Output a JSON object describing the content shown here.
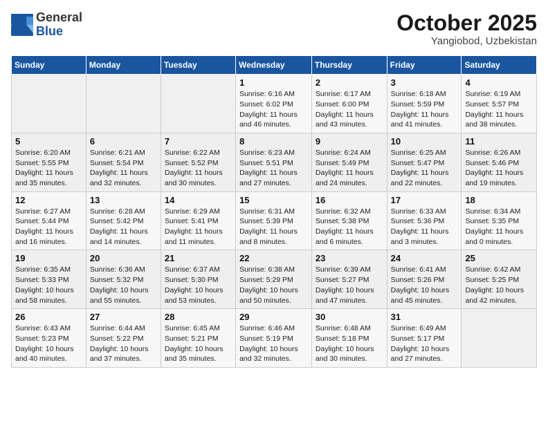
{
  "header": {
    "logo": {
      "general": "General",
      "blue": "Blue"
    },
    "month": "October 2025",
    "location": "Yangiobod, Uzbekistan"
  },
  "weekdays": [
    "Sunday",
    "Monday",
    "Tuesday",
    "Wednesday",
    "Thursday",
    "Friday",
    "Saturday"
  ],
  "weeks": [
    [
      {
        "day": "",
        "detail": ""
      },
      {
        "day": "",
        "detail": ""
      },
      {
        "day": "",
        "detail": ""
      },
      {
        "day": "1",
        "detail": "Sunrise: 6:16 AM\nSunset: 6:02 PM\nDaylight: 11 hours and 46 minutes."
      },
      {
        "day": "2",
        "detail": "Sunrise: 6:17 AM\nSunset: 6:00 PM\nDaylight: 11 hours and 43 minutes."
      },
      {
        "day": "3",
        "detail": "Sunrise: 6:18 AM\nSunset: 5:59 PM\nDaylight: 11 hours and 41 minutes."
      },
      {
        "day": "4",
        "detail": "Sunrise: 6:19 AM\nSunset: 5:57 PM\nDaylight: 11 hours and 38 minutes."
      }
    ],
    [
      {
        "day": "5",
        "detail": "Sunrise: 6:20 AM\nSunset: 5:55 PM\nDaylight: 11 hours and 35 minutes."
      },
      {
        "day": "6",
        "detail": "Sunrise: 6:21 AM\nSunset: 5:54 PM\nDaylight: 11 hours and 32 minutes."
      },
      {
        "day": "7",
        "detail": "Sunrise: 6:22 AM\nSunset: 5:52 PM\nDaylight: 11 hours and 30 minutes."
      },
      {
        "day": "8",
        "detail": "Sunrise: 6:23 AM\nSunset: 5:51 PM\nDaylight: 11 hours and 27 minutes."
      },
      {
        "day": "9",
        "detail": "Sunrise: 6:24 AM\nSunset: 5:49 PM\nDaylight: 11 hours and 24 minutes."
      },
      {
        "day": "10",
        "detail": "Sunrise: 6:25 AM\nSunset: 5:47 PM\nDaylight: 11 hours and 22 minutes."
      },
      {
        "day": "11",
        "detail": "Sunrise: 6:26 AM\nSunset: 5:46 PM\nDaylight: 11 hours and 19 minutes."
      }
    ],
    [
      {
        "day": "12",
        "detail": "Sunrise: 6:27 AM\nSunset: 5:44 PM\nDaylight: 11 hours and 16 minutes."
      },
      {
        "day": "13",
        "detail": "Sunrise: 6:28 AM\nSunset: 5:42 PM\nDaylight: 11 hours and 14 minutes."
      },
      {
        "day": "14",
        "detail": "Sunrise: 6:29 AM\nSunset: 5:41 PM\nDaylight: 11 hours and 11 minutes."
      },
      {
        "day": "15",
        "detail": "Sunrise: 6:31 AM\nSunset: 5:39 PM\nDaylight: 11 hours and 8 minutes."
      },
      {
        "day": "16",
        "detail": "Sunrise: 6:32 AM\nSunset: 5:38 PM\nDaylight: 11 hours and 6 minutes."
      },
      {
        "day": "17",
        "detail": "Sunrise: 6:33 AM\nSunset: 5:36 PM\nDaylight: 11 hours and 3 minutes."
      },
      {
        "day": "18",
        "detail": "Sunrise: 6:34 AM\nSunset: 5:35 PM\nDaylight: 11 hours and 0 minutes."
      }
    ],
    [
      {
        "day": "19",
        "detail": "Sunrise: 6:35 AM\nSunset: 5:33 PM\nDaylight: 10 hours and 58 minutes."
      },
      {
        "day": "20",
        "detail": "Sunrise: 6:36 AM\nSunset: 5:32 PM\nDaylight: 10 hours and 55 minutes."
      },
      {
        "day": "21",
        "detail": "Sunrise: 6:37 AM\nSunset: 5:30 PM\nDaylight: 10 hours and 53 minutes."
      },
      {
        "day": "22",
        "detail": "Sunrise: 6:38 AM\nSunset: 5:29 PM\nDaylight: 10 hours and 50 minutes."
      },
      {
        "day": "23",
        "detail": "Sunrise: 6:39 AM\nSunset: 5:27 PM\nDaylight: 10 hours and 47 minutes."
      },
      {
        "day": "24",
        "detail": "Sunrise: 6:41 AM\nSunset: 5:26 PM\nDaylight: 10 hours and 45 minutes."
      },
      {
        "day": "25",
        "detail": "Sunrise: 6:42 AM\nSunset: 5:25 PM\nDaylight: 10 hours and 42 minutes."
      }
    ],
    [
      {
        "day": "26",
        "detail": "Sunrise: 6:43 AM\nSunset: 5:23 PM\nDaylight: 10 hours and 40 minutes."
      },
      {
        "day": "27",
        "detail": "Sunrise: 6:44 AM\nSunset: 5:22 PM\nDaylight: 10 hours and 37 minutes."
      },
      {
        "day": "28",
        "detail": "Sunrise: 6:45 AM\nSunset: 5:21 PM\nDaylight: 10 hours and 35 minutes."
      },
      {
        "day": "29",
        "detail": "Sunrise: 6:46 AM\nSunset: 5:19 PM\nDaylight: 10 hours and 32 minutes."
      },
      {
        "day": "30",
        "detail": "Sunrise: 6:48 AM\nSunset: 5:18 PM\nDaylight: 10 hours and 30 minutes."
      },
      {
        "day": "31",
        "detail": "Sunrise: 6:49 AM\nSunset: 5:17 PM\nDaylight: 10 hours and 27 minutes."
      },
      {
        "day": "",
        "detail": ""
      }
    ]
  ]
}
